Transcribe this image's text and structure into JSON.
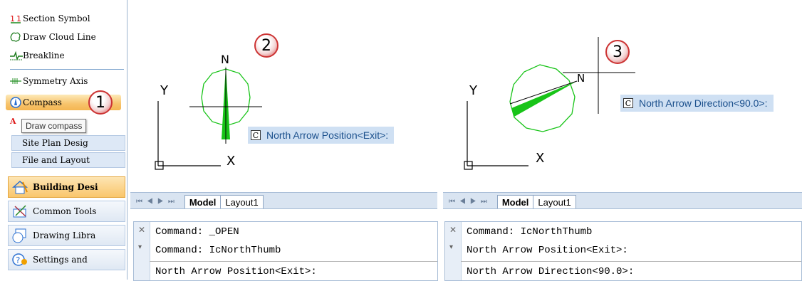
{
  "sidebar": {
    "items": [
      {
        "label": "Section Symbol",
        "icon": "section-symbol-icon"
      },
      {
        "label": "Draw Cloud Line",
        "icon": "cloud-line-icon"
      },
      {
        "label": "Breakline",
        "icon": "breakline-icon"
      },
      {
        "label": "Symmetry Axis",
        "icon": "symmetry-axis-icon"
      },
      {
        "label": "Compass",
        "icon": "compass-icon"
      }
    ],
    "tooltip": "Draw compass",
    "sub_buttons": [
      "Site Plan Desig",
      "File and Layout"
    ],
    "categories": [
      {
        "label": "Building Desi",
        "icon": "building-design-icon"
      },
      {
        "label": "Common Tools",
        "icon": "common-tools-icon"
      },
      {
        "label": "Drawing Libra",
        "icon": "drawing-library-icon"
      },
      {
        "label": "Settings and",
        "icon": "settings-icon"
      }
    ],
    "partial_item_letters": "A"
  },
  "markers": [
    "1",
    "2",
    "3"
  ],
  "panel_left": {
    "north_label": "N",
    "axis_y": "Y",
    "axis_x": "X",
    "prompt_icon": "C",
    "prompt": "North Arrow Position<Exit>:",
    "tabs": [
      "Model",
      "Layout1"
    ],
    "command_lines": [
      "Command: _OPEN",
      "Command: IcNorthThumb"
    ],
    "command_input": "North Arrow Position<Exit>:"
  },
  "panel_right": {
    "north_label": "N",
    "axis_y": "Y",
    "axis_x": "X",
    "prompt_icon": "C",
    "prompt": "North Arrow Direction<90.0>:",
    "tabs": [
      "Model",
      "Layout1"
    ],
    "command_lines": [
      "Command: IcNorthThumb",
      "North Arrow Position<Exit>:"
    ],
    "command_input": "North Arrow Direction<90.0>:"
  },
  "colors": {
    "compass_green": "#18c418",
    "active_orange": "#f7c36b",
    "marker_red": "#d84a4a",
    "tab_blue": "#d9e4f1"
  }
}
